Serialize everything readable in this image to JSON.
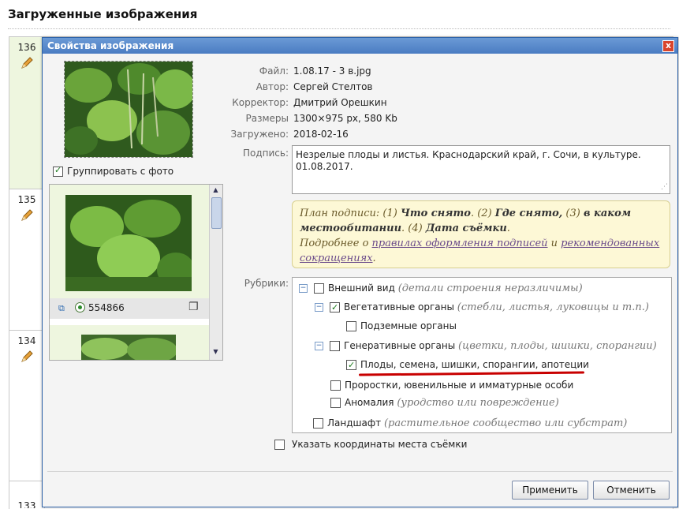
{
  "page": {
    "title": "Загруженные изображения"
  },
  "list": {
    "row_numbers": [
      "136",
      "135",
      "134",
      "133"
    ]
  },
  "dialog": {
    "title": "Свойства изображения",
    "close_glyph": "x",
    "group_label": "Группировать с фото",
    "group_checked": true,
    "thumb_id": "554866",
    "info": {
      "file_label": "Файл:",
      "file_value": "1.08.17 - 3 в.jpg",
      "author_label": "Автор:",
      "author_value": "Сергей Стелтов",
      "editor_label": "Корректор:",
      "editor_value": "Дмитрий Орешкин",
      "size_label": "Размеры",
      "size_value": "1300×975 px, 580 Kb",
      "uploaded_label": "Загружено:",
      "uploaded_value": "2018-02-16"
    },
    "caption_label": "Подпись:",
    "caption_value": "Незрелые плоды и листья. Краснодарский край, г. Сочи, в культуре. 01.08.2017.",
    "hint": {
      "t1": "План подписи: (1) ",
      "b1": "Что снято",
      "t2": ". (2) ",
      "b2": "Где снято,",
      "t3": " (3) ",
      "b3": "в каком местообитании",
      "t4": ". (4) ",
      "b4": "Дата съёмки",
      "t5": ".",
      "t6": "Подробнее о ",
      "link1": "правилах оформления подписей",
      "t7": " и ",
      "link2": "рекомендованных сокращениях",
      "t8": "."
    },
    "rubrics_label": "Рубрики:",
    "rubrics": [
      {
        "label": "Внешний вид",
        "note": "(детали строения неразличимы)",
        "checked": false
      },
      {
        "label": "Вегетативные органы",
        "note": "(стебли, листья, луковицы и т.п.)",
        "checked": true
      },
      {
        "label": "Подземные органы",
        "note": "",
        "checked": false
      },
      {
        "label": "Генеративные органы",
        "note": "(цветки, плоды, шишки, спорангии)",
        "checked": false
      },
      {
        "label": "Плоды, семена, шишки, спорангии, апотеции",
        "note": "",
        "checked": true
      },
      {
        "label": "Проростки, ювенильные и имматурные особи",
        "note": "",
        "checked": false
      },
      {
        "label": "Аномалия",
        "note": "(уродство или повреждение)",
        "checked": false
      },
      {
        "label": "Ландшафт",
        "note": "(растительное сообщество или субстрат)",
        "checked": false
      }
    ],
    "coords_label": "Указать координаты места съёмки",
    "apply_label": "Применить",
    "cancel_label": "Отменить"
  },
  "colors": {
    "accent": "#4a7cc2",
    "highlight_underline": "#cc0000",
    "hint_bg": "#fdf8d6"
  }
}
